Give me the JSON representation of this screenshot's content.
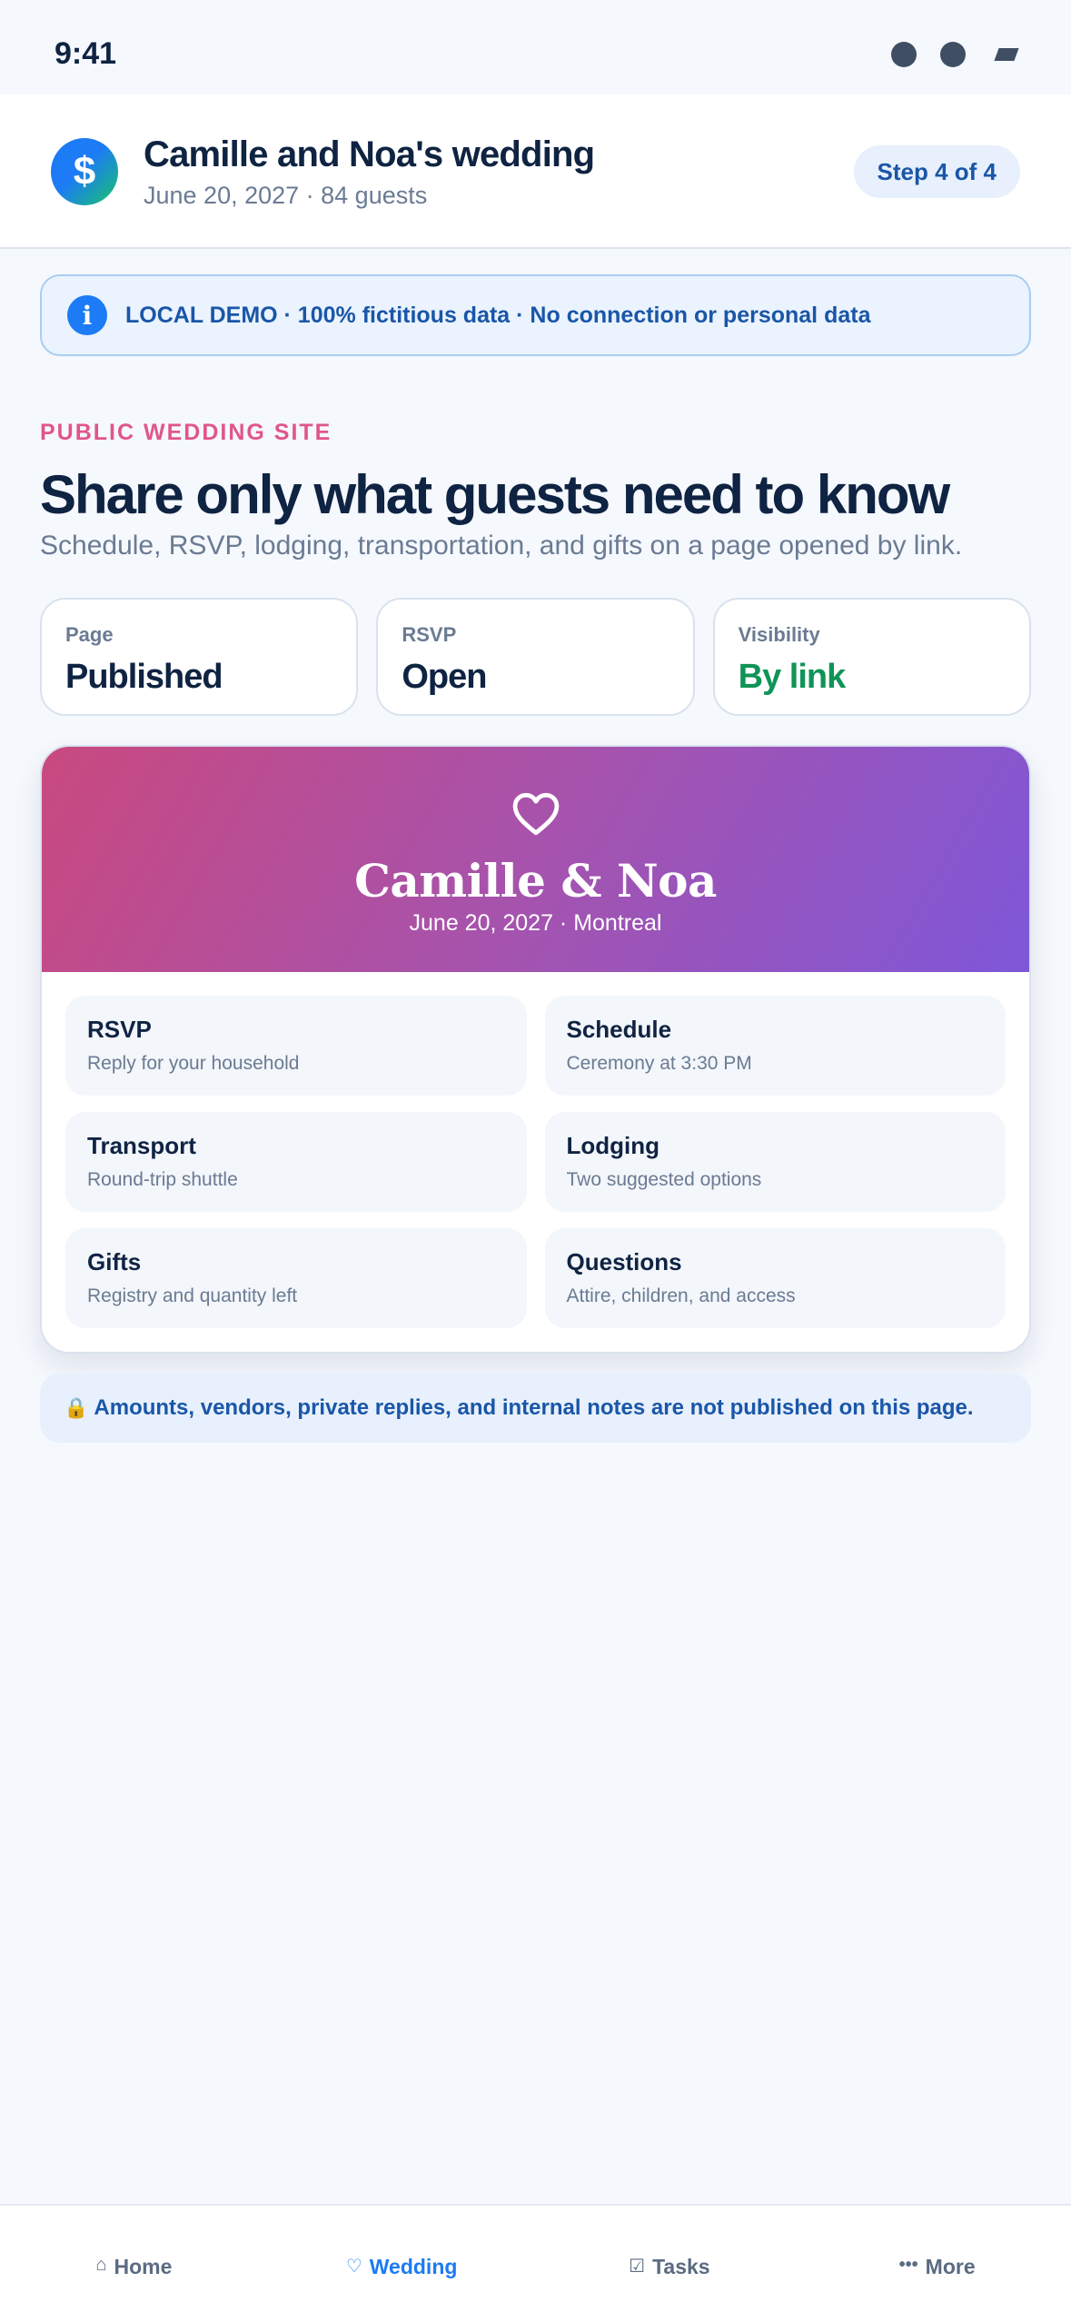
{
  "status_bar": {
    "time": "9:41"
  },
  "header": {
    "logo_glyph": "$",
    "title": "Camille and Noa's wedding",
    "subtitle": "June 20, 2027 · 84 guests",
    "step": "Step 4 of 4"
  },
  "demo_banner": {
    "icon": "i",
    "text": "LOCAL DEMO · 100% fictitious data · No connection or personal data"
  },
  "intro": {
    "eyebrow": "PUBLIC WEDDING SITE",
    "headline": "Share only what guests need to know",
    "lede": "Schedule, RSVP, lodging, transportation, and gifts on a page opened by link."
  },
  "stats": [
    {
      "label": "Page",
      "value": "Published"
    },
    {
      "label": "RSVP",
      "value": "Open"
    },
    {
      "label": "Visibility",
      "value": "By link"
    }
  ],
  "preview": {
    "title": "Camille & Noa",
    "subtitle": "June 20, 2027 · Montreal",
    "tiles": [
      {
        "title": "RSVP",
        "sub": "Reply for your household"
      },
      {
        "title": "Schedule",
        "sub": "Ceremony at 3:30 PM"
      },
      {
        "title": "Transport",
        "sub": "Round-trip shuttle"
      },
      {
        "title": "Lodging",
        "sub": "Two suggested options"
      },
      {
        "title": "Gifts",
        "sub": "Registry and quantity left"
      },
      {
        "title": "Questions",
        "sub": "Attire, children, and access"
      }
    ]
  },
  "privacy": {
    "text": "Amounts, vendors, private replies, and internal notes are not published on this page."
  },
  "nav": [
    {
      "label": "Home",
      "icon": "⌂"
    },
    {
      "label": "Wedding",
      "icon": "♡"
    },
    {
      "label": "Tasks",
      "icon": "☑"
    },
    {
      "label": "More",
      "icon": "•••"
    }
  ],
  "colors": {
    "accent": "#1c7bf5",
    "eyebrow": "#e0568a",
    "visibility_value": "#0f9457",
    "hero_gradient_start": "#c9497f",
    "hero_gradient_end": "#7e57d8"
  }
}
